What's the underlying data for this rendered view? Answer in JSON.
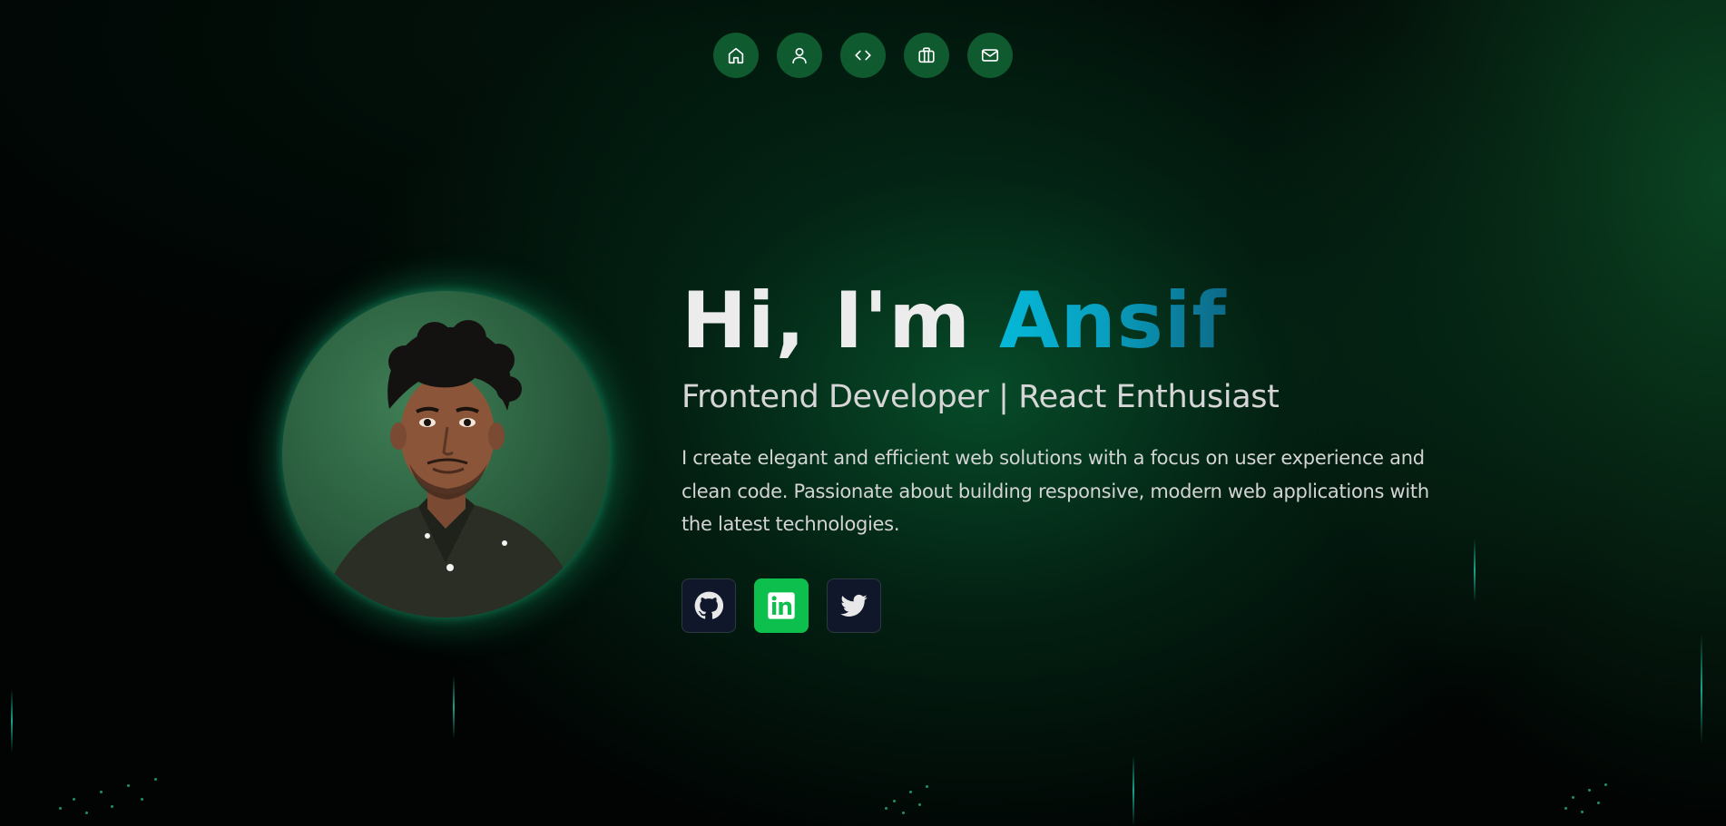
{
  "nav": {
    "items": [
      {
        "icon": "home-icon"
      },
      {
        "icon": "user-icon"
      },
      {
        "icon": "code-icon"
      },
      {
        "icon": "briefcase-icon"
      },
      {
        "icon": "mail-icon"
      }
    ]
  },
  "hero": {
    "greeting": "Hi, I'm ",
    "name": "Ansif",
    "subtitle": "Frontend Developer | React Enthusiast",
    "description": "I create elegant and efficient web solutions with a focus on user experience and clean code. Passionate about building responsive, modern web applications with the latest technologies."
  },
  "socials": [
    {
      "icon": "github-icon"
    },
    {
      "icon": "linkedin-icon",
      "active": true
    },
    {
      "icon": "twitter-icon"
    }
  ],
  "colors": {
    "accent": "#06b8d8",
    "nav_bg": "#0f5a2e",
    "active_social": "#0dbf4c"
  }
}
